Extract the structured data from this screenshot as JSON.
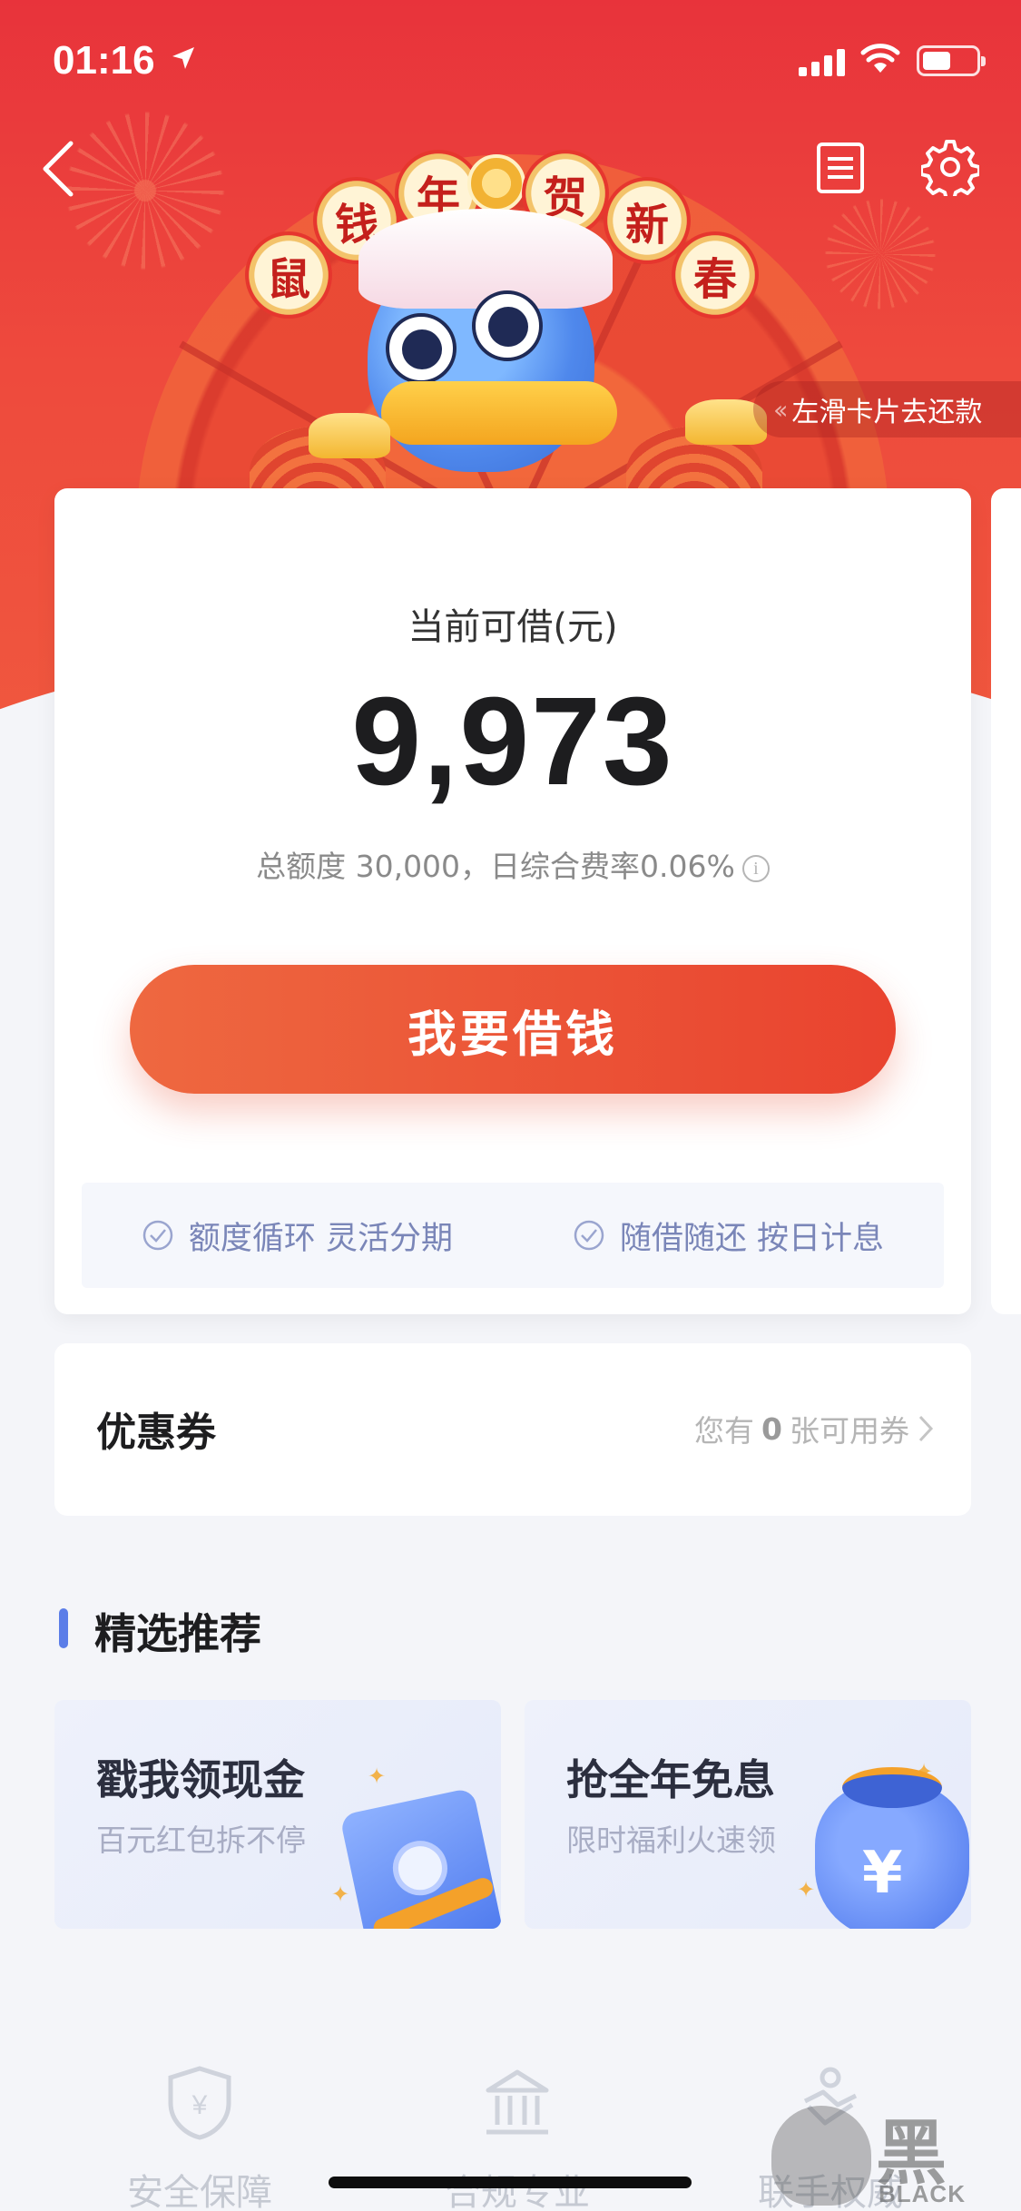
{
  "status_bar": {
    "time": "01:16"
  },
  "banner": {
    "couplet_chars": [
      "鼠",
      "钱",
      "年",
      "贺",
      "新",
      "春"
    ],
    "slide_hint": "左滑卡片去还款"
  },
  "loan_card": {
    "available_label": "当前可借(元)",
    "available_amount": "9,973",
    "limit_info": "总额度 30,000，日综合费率0.06%",
    "borrow_button": "我要借钱",
    "features": [
      "额度循环 灵活分期",
      "随借随还 按日计息"
    ]
  },
  "coupon": {
    "title": "优惠券",
    "prefix": "您有",
    "count": "0",
    "suffix": "张可用券"
  },
  "recommend": {
    "title": "精选推荐",
    "items": [
      {
        "title": "戳我领现金",
        "subtitle": "百元红包拆不停"
      },
      {
        "title": "抢全年免息",
        "subtitle": "限时福利火速领"
      }
    ]
  },
  "trust": [
    {
      "label": "安全保障",
      "icon": "shield-yen-icon"
    },
    {
      "label": "合规专业",
      "icon": "bank-building-icon"
    },
    {
      "label": "联手权威",
      "icon": "handshake-icon"
    }
  ],
  "watermark": {
    "text": "黑猫",
    "sub": "BLACK CAT"
  },
  "colors": {
    "banner": "#e8333b",
    "button": "#e9432f",
    "accent": "#5b7de8",
    "feature_text": "#7a86b8"
  }
}
